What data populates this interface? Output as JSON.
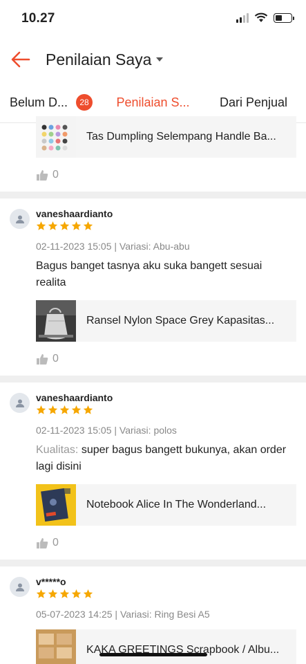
{
  "status_bar": {
    "time": "10.27",
    "battery_level": 0.45
  },
  "header": {
    "title": "Penilaian Saya"
  },
  "tabs": [
    {
      "label": "Belum D...",
      "badge": "28"
    },
    {
      "label": "Penilaian S...",
      "active": true
    },
    {
      "label": "Dari Penjual"
    }
  ],
  "colors": {
    "accent": "#ee4d2d",
    "star": "#f6a700",
    "divider": "#efefef"
  },
  "reviews": [
    {
      "product": {
        "name": "Tas Dumpling Selempang Handle Ba...",
        "thumb": "tote-bags-grid"
      },
      "likes": "0"
    },
    {
      "username": "vaneshaardianto",
      "rating": 5,
      "meta": "02-11-2023 15:05 | Variasi: Abu-abu",
      "text": "Bagus banget tasnya aku suka bangett sesuai realita",
      "product": {
        "name": "Ransel Nylon Space Grey Kapasitas...",
        "thumb": "grey-bag"
      },
      "likes": "0"
    },
    {
      "username": "vaneshaardianto",
      "rating": 5,
      "meta": "02-11-2023 15:05 | Variasi: polos",
      "label": "Kualitas:",
      "text": "super bagus bangett bukunya, akan order lagi disini",
      "product": {
        "name": "Notebook Alice In The Wonderland...",
        "thumb": "yellow-notebook"
      },
      "likes": "0"
    },
    {
      "username": "v*****o",
      "rating": 5,
      "meta": "05-07-2023 14:25 | Variasi: Ring Besi A5",
      "product": {
        "name": "KAKA GREETINGS Scrapbook / Albu...",
        "thumb": "scrapbook-stack"
      }
    }
  ]
}
